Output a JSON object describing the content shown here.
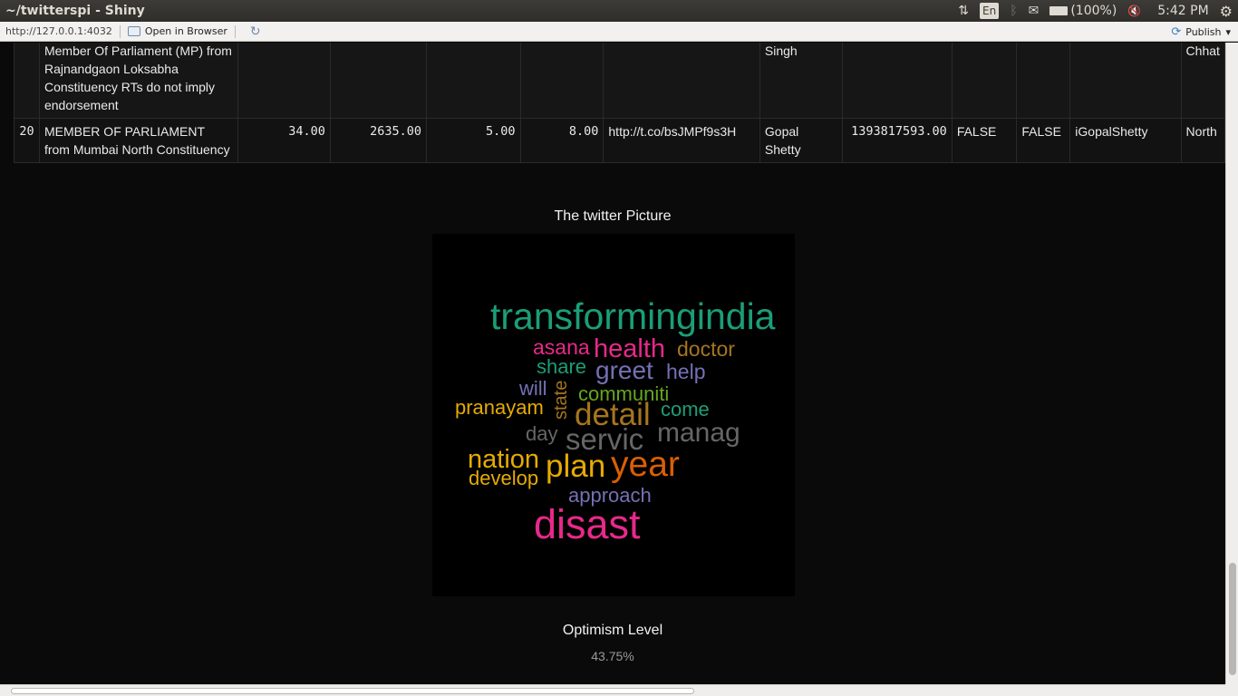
{
  "window": {
    "title": "~/twitterspi - Shiny"
  },
  "tray": {
    "network_icon": "⇅",
    "keyboard": "En",
    "bluetooth_icon": "ᛒ",
    "mail_icon": "✉",
    "battery": "(100%)",
    "volume_icon": "🔇",
    "time": "5:42 PM",
    "settings_icon": "⚙"
  },
  "viewer": {
    "url": "http://127.0.0.1:4032",
    "open_browser": "Open in Browser",
    "refresh_icon": "↻",
    "publish": "Publish",
    "publish_icon": "⟳",
    "publish_caret": "▾"
  },
  "table": {
    "rows": [
      {
        "rownum": "",
        "description": "Member Of Parliament (MP) from Rajnandgaon Loksabha Constituency RTs do not imply endorsement",
        "c1": "",
        "c2": "",
        "c3": "",
        "c4": "",
        "url": "",
        "name": "Singh",
        "c5": "",
        "c6": "",
        "c7": "",
        "handle": "",
        "location": "Chhat"
      },
      {
        "rownum": "20",
        "description": "MEMBER OF PARLIAMENT from Mumbai North Constituency",
        "c1": "34.00",
        "c2": "2635.00",
        "c3": "5.00",
        "c4": "8.00",
        "url": "http://t.co/bsJMPf9s3H",
        "name": "Gopal Shetty",
        "c5": "1393817593.00",
        "c6": "FALSE",
        "c7": "FALSE",
        "handle": "iGopalShetty",
        "location": "North"
      }
    ]
  },
  "wordcloud": {
    "title": "The twitter Picture",
    "words": [
      {
        "text": "transformingindia",
        "color": "#1b9e77"
      },
      {
        "text": "asana",
        "color": "#e7298a"
      },
      {
        "text": "health",
        "color": "#e7298a"
      },
      {
        "text": "doctor",
        "color": "#a6761d"
      },
      {
        "text": "share",
        "color": "#1b9e77"
      },
      {
        "text": "greet",
        "color": "#7570b3"
      },
      {
        "text": "help",
        "color": "#7570b3"
      },
      {
        "text": "will",
        "color": "#7570b3"
      },
      {
        "text": "state",
        "color": "#a6761d"
      },
      {
        "text": "communiti",
        "color": "#66a61e"
      },
      {
        "text": "pranayam",
        "color": "#e6ab02"
      },
      {
        "text": "detail",
        "color": "#a6761d"
      },
      {
        "text": "come",
        "color": "#1b9e77"
      },
      {
        "text": "day",
        "color": "#666666"
      },
      {
        "text": "servic",
        "color": "#666666"
      },
      {
        "text": "manag",
        "color": "#666666"
      },
      {
        "text": "nation",
        "color": "#e6ab02"
      },
      {
        "text": "plan",
        "color": "#e6ab02"
      },
      {
        "text": "year",
        "color": "#d95f02"
      },
      {
        "text": "develop",
        "color": "#e6ab02"
      },
      {
        "text": "approach",
        "color": "#7570b3"
      },
      {
        "text": "disast",
        "color": "#e7298a"
      }
    ]
  },
  "optimism": {
    "title": "Optimism Level",
    "value": "43.75%"
  }
}
